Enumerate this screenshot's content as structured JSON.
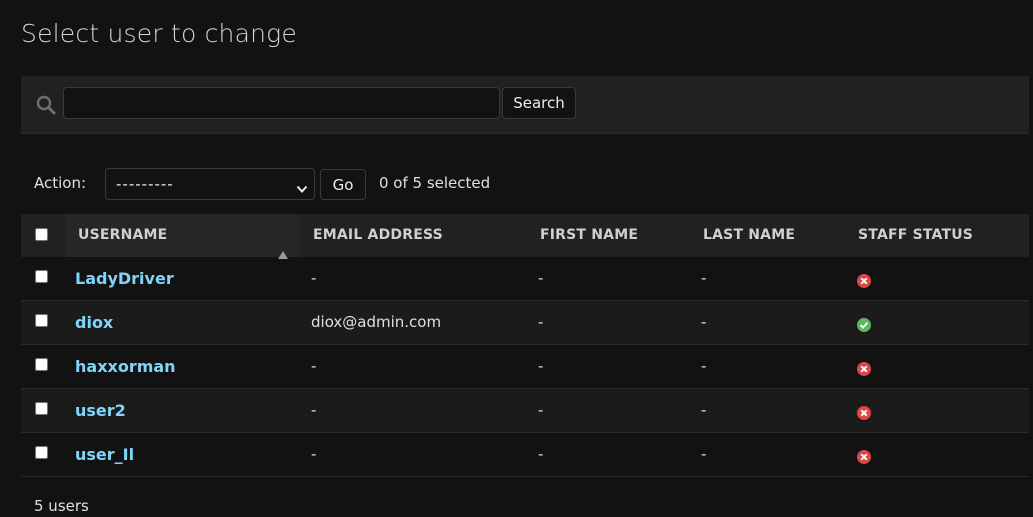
{
  "page": {
    "title": "Select user to change"
  },
  "search": {
    "value": "",
    "placeholder": "",
    "button_label": "Search"
  },
  "actions": {
    "label": "Action:",
    "selected": "---------",
    "go_label": "Go",
    "selection_count": "0 of 5 selected"
  },
  "table": {
    "columns": {
      "username": "USERNAME",
      "email": "EMAIL ADDRESS",
      "first_name": "FIRST NAME",
      "last_name": "LAST NAME",
      "staff_status": "STAFF STATUS"
    },
    "rows": [
      {
        "username": "LadyDriver",
        "email": "-",
        "first_name": "-",
        "last_name": "-",
        "staff": false
      },
      {
        "username": "diox",
        "email": "diox@admin.com",
        "first_name": "-",
        "last_name": "-",
        "staff": true
      },
      {
        "username": "haxxorman",
        "email": "-",
        "first_name": "-",
        "last_name": "-",
        "staff": false
      },
      {
        "username": "user2",
        "email": "-",
        "first_name": "-",
        "last_name": "-",
        "staff": false
      },
      {
        "username": "user_Il",
        "email": "-",
        "first_name": "-",
        "last_name": "-",
        "staff": false
      }
    ]
  },
  "footer": {
    "count": "5 users"
  },
  "colors": {
    "link": "#81d4fa",
    "staff_yes": "#5cb85c",
    "staff_no": "#dd4646"
  },
  "icons": {
    "search": "search-icon",
    "select": "chevron-down-icon",
    "sort": "sort-ascending-icon",
    "staff_yes": "check-circle-icon",
    "staff_no": "x-circle-icon"
  }
}
